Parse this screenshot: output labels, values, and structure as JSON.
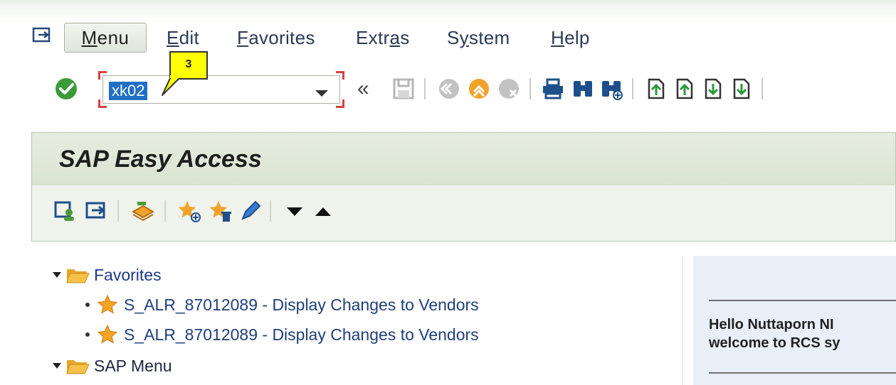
{
  "menubar": {
    "menu_label": "Menu",
    "items": [
      {
        "label": "Edit",
        "underline_index": 0
      },
      {
        "label": "Favorites",
        "underline_index": 0
      },
      {
        "label": "Extras",
        "underline_index": 4
      },
      {
        "label": "System",
        "underline_index": 1
      },
      {
        "label": "Help",
        "underline_index": 0
      }
    ]
  },
  "toolbar": {
    "command_field_value": "xk02",
    "back_label": "«",
    "callout_number": "3"
  },
  "easy_access": {
    "title": "SAP Easy Access"
  },
  "tree": {
    "favorites_label": "Favorites",
    "favorite_items": [
      "S_ALR_87012089 - Display Changes to Vendors",
      "S_ALR_87012089 - Display Changes to Vendors"
    ],
    "sap_menu_label": "SAP Menu"
  },
  "welcome": {
    "line1": "Hello Nuttaporn NI",
    "line2": "welcome to RCS sy"
  },
  "colors": {
    "selection_blue": "#1f6fc6",
    "callout_yellow": "#ffff00",
    "tree_link": "#1f3f7a",
    "enter_green": "#3a9a3a"
  }
}
